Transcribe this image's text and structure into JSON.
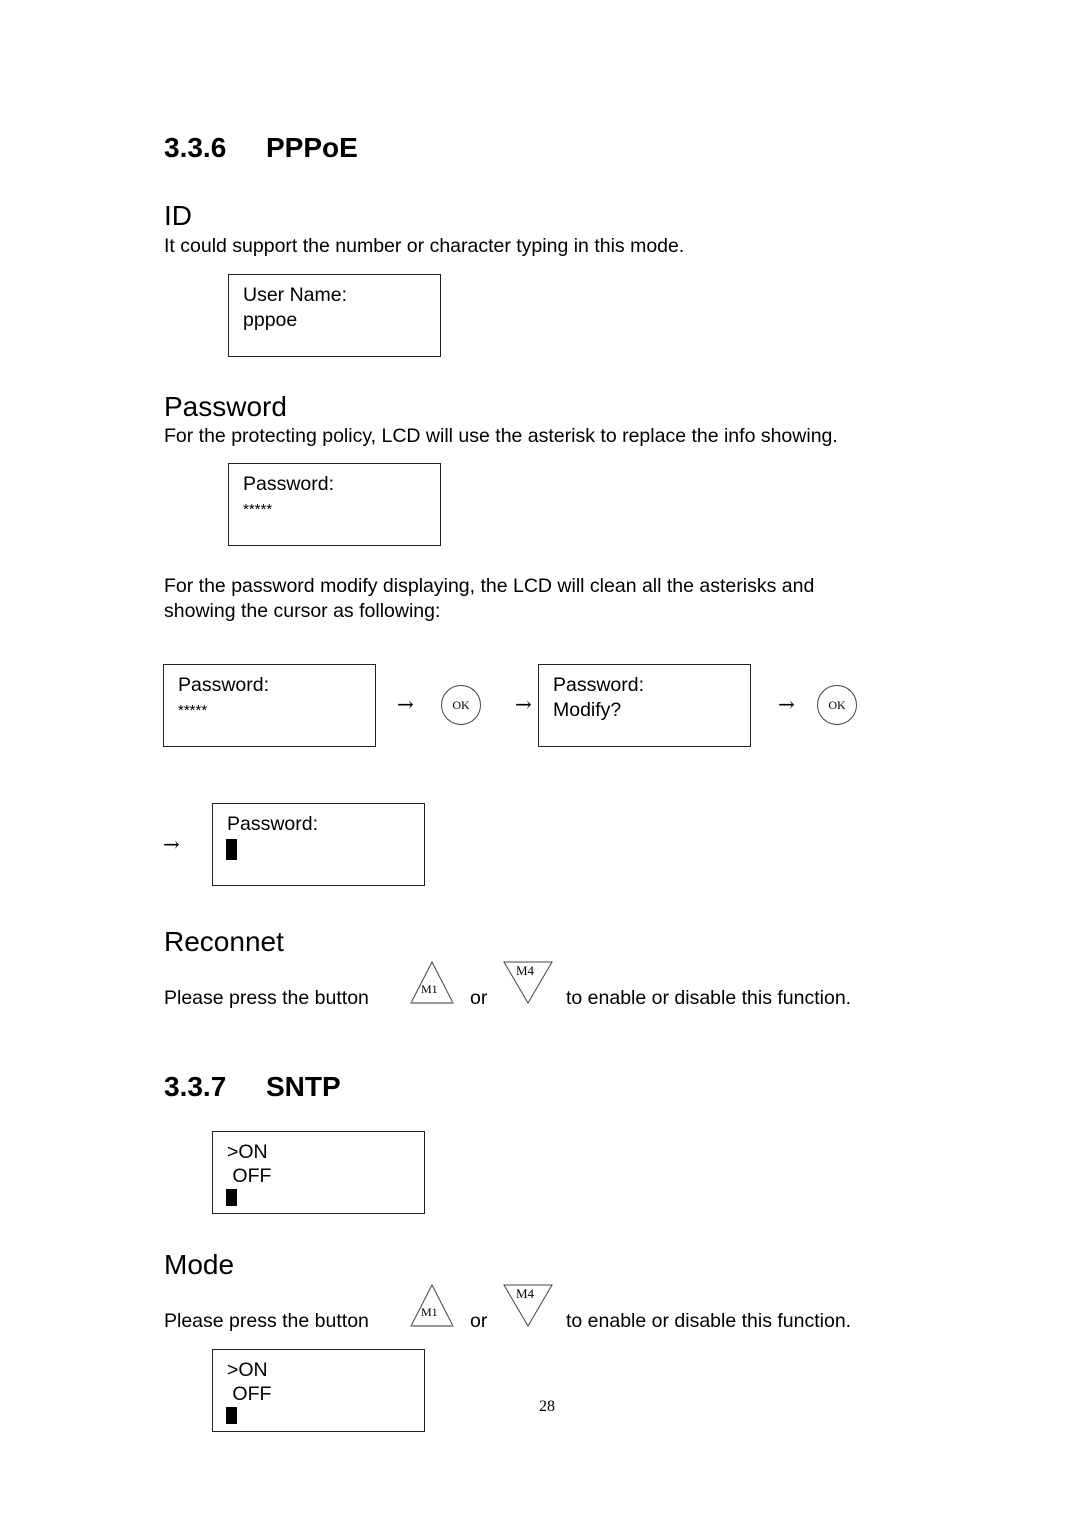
{
  "sections": {
    "pppoe": {
      "number": "3.3.6",
      "title": "PPPoE"
    },
    "sntp": {
      "number": "3.3.7",
      "title": "SNTP"
    }
  },
  "id_section": {
    "heading": "ID",
    "description": "It could support the number or character typing in this mode.",
    "lcd": {
      "line1": "User Name:",
      "line2": "pppoe"
    }
  },
  "password_section": {
    "heading": "Password",
    "description": "For the protecting policy, LCD will use the asterisk to replace the info showing.",
    "lcd": {
      "line1": "Password:",
      "line2": "*****"
    },
    "modify_description_line1": "For the password modify displaying, the LCD will clean all the asterisks and",
    "modify_description_line2": "showing the cursor as following:",
    "flow": {
      "step1": {
        "line1": "Password:",
        "line2": "*****"
      },
      "ok_label": "OK",
      "step2": {
        "line1": "Password:",
        "line2": "Modify?"
      },
      "step3": {
        "line1": "Password:"
      },
      "arrow": "→"
    }
  },
  "reconnect_section": {
    "heading": "Reconnet",
    "instruction_prefix": "Please press the button",
    "instruction_or": "or",
    "instruction_suffix": "to enable or disable this function.",
    "button_up_label": "M1",
    "button_down_label": "M4"
  },
  "sntp_section": {
    "lcd": {
      "line1": ">ON",
      "line2": " OFF"
    }
  },
  "mode_section": {
    "heading": "Mode",
    "instruction_prefix": "Please press the button",
    "instruction_or": "or",
    "instruction_suffix": "to enable or disable this function.",
    "button_up_label": "M1",
    "button_down_label": "M4",
    "lcd": {
      "line1": ">ON",
      "line2": " OFF"
    }
  },
  "page_number": "28"
}
